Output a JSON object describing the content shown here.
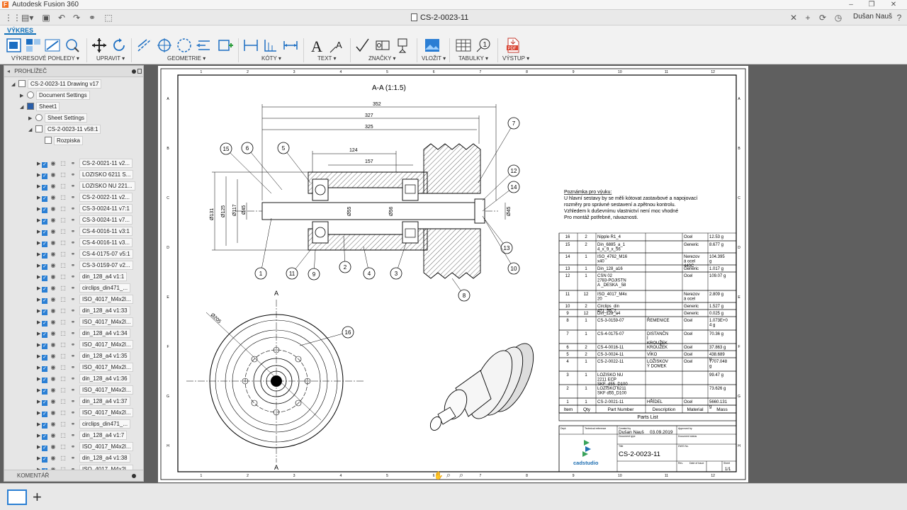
{
  "app": {
    "title": "Autodesk Fusion 360",
    "user": "Dušan Nauš",
    "document_tab": "CS-2-0023-11 Drawing v17"
  },
  "ribbon": {
    "tab": "VÝKRES",
    "groups": [
      "VÝKRESOVÉ POHLEDY ▾",
      "UPRAVIT ▾",
      "GEOMETRIE ▾",
      "KÓTY ▾",
      "TEXT ▾",
      "ZNAČKY ▾",
      "VLOŽIT ▾",
      "TABULKY ▾",
      "VÝSTUP ▾"
    ]
  },
  "browser": {
    "title": "PROHLÍŽEČ",
    "comments": "KOMENTÁŘ",
    "root": "CS-2-0023-11 Drawing v17",
    "document_settings": "Document Settings",
    "sheet": "Sheet1",
    "sheet_settings": "Sheet Settings",
    "view": "CS-2-0023-11 v58:1",
    "parts_list": "Rozpiska",
    "components": [
      "CS-2-0021-11 v2...",
      "LOZISKO 6211 S...",
      "LOZISKO NU 221...",
      "CS-2-0022-11 v2...",
      "CS-3-0024-11 v7:1",
      "CS-3-0024-11 v7...",
      "CS-4-0016-11 v3:1",
      "CS-4-0016-11 v3...",
      "CS-4-0175-07 v5:1",
      "CS-3-0159-07 v2...",
      "din_128_a4 v1:1",
      "circlips_din471_...",
      "ISO_4017_M4x2l...",
      "din_128_a4 v1:33",
      "ISO_4017_M4x2l...",
      "din_128_a4 v1:34",
      "ISO_4017_M4x2l...",
      "din_128_a4 v1:35",
      "ISO_4017_M4x2l...",
      "din_128_a4 v1:36",
      "ISO_4017_M4x2l...",
      "din_128_a4 v1:37",
      "ISO_4017_M4x2l...",
      "circlips_din471_...",
      "din_128_a4 v1:7",
      "ISO_4017_M4x2l...",
      "din_128_a4 v1:38",
      "ISO_4017_M4x2l..."
    ]
  },
  "drawing": {
    "section_title": "A-A (1:1.5)",
    "section_marker": "A",
    "dimensions": [
      "352",
      "327",
      "325",
      "124",
      "157",
      "Ø131",
      "Ø125",
      "Ø117",
      "Ø45",
      "Ø55",
      "Ø56",
      "Ø45",
      "Ø205"
    ],
    "balloons": [
      "15",
      "6",
      "5",
      "7",
      "12",
      "14",
      "13",
      "10",
      "8",
      "3",
      "4",
      "2",
      "9",
      "11",
      "1",
      "16"
    ],
    "note_title": "Poznámka pro výuku:",
    "note_lines": [
      "U hlavní sestavy by se měli kótovat zastavbové a napojovací",
      "rozměry pro správné sestavení a zpětnou kontrolu.",
      "Vzhledem k duševnímu vlastnictví není moc vhodné",
      "Pro montáž potřebné, návaznosti."
    ],
    "grid_cols": [
      "1",
      "2",
      "3",
      "4",
      "5",
      "6",
      "7",
      "8",
      "9",
      "10",
      "11",
      "12"
    ],
    "grid_rows": [
      "A",
      "B",
      "C",
      "D",
      "E",
      "F",
      "G",
      "H"
    ],
    "parts_list": {
      "title": "Parts List",
      "headers": [
        "Item",
        "Qty",
        "Part Number",
        "Description",
        "Material",
        "Mass"
      ],
      "rows": [
        [
          "16",
          "2",
          "Nipple R1_4",
          "",
          "Ocel",
          "12.53 g"
        ],
        [
          "15",
          "2",
          "Din_6885_a_14_x_9_x_56",
          "",
          "Generic",
          "8.677 g"
        ],
        [
          "14",
          "1",
          "ISO_4762_M16x40",
          "",
          "Nerezová ocel 440C",
          "104.395 g"
        ],
        [
          "13",
          "1",
          "Din_128_a16",
          "",
          "Generic",
          "1.017 g"
        ],
        [
          "12",
          "1",
          "CSN 02 2783-POJISTNA _DESKA _58",
          "",
          "Ocel",
          "109.07 g"
        ],
        [
          "11",
          "12",
          "ISO_4017_M4x20",
          "",
          "Nerezová ocel",
          "2.809 g"
        ],
        [
          "10",
          "2",
          "Circlips_din471_55_2",
          "",
          "Generic",
          "1.527 g"
        ],
        [
          "9",
          "12",
          "Din_128_a4",
          "",
          "Generic",
          "0.025 g"
        ],
        [
          "8",
          "1",
          "CS-3-0159-07",
          "ŘEMENICE",
          "Ocel",
          "1.073E+04 g"
        ],
        [
          "7",
          "1",
          "CS-4-0175-07",
          "DISTANČNÍ KROUŽEK",
          "Ocel",
          "70.36 g"
        ],
        [
          "6",
          "2",
          "CS-4-0016-11",
          "KROUŽEK",
          "Ocel",
          "37.863 g"
        ],
        [
          "5",
          "2",
          "CS-3-0024-11",
          "VÍKO",
          "Ocel",
          "438.689 g"
        ],
        [
          "4",
          "1",
          "CS-2-0022-11",
          "LOŽISKOVÝ DOMEK",
          "Ocel",
          "7707.048 g"
        ],
        [
          "3",
          "1",
          "LOZISKO NU 2211 ECP SKF_d55_D100",
          "",
          "",
          "99.47 g"
        ],
        [
          "2",
          "1",
          "LOZISKO 6211 SKF d55_D100",
          "",
          "",
          "73.626 g"
        ],
        [
          "1",
          "1",
          "CS-2-0021-11",
          "HŘÍDEL",
          "Ocel",
          "5660.131 g"
        ]
      ]
    },
    "title_block": {
      "dept_label": "Dept.",
      "tech_ref_label": "Technical reference",
      "created_by_label": "Created by",
      "approved_by_label": "Approved by",
      "created_by": "Dušan Nauš",
      "date": "03.09.2019",
      "doc_type_label": "Document type",
      "doc_status_label": "Document status",
      "title_label": "Title",
      "dwg_no_label": "DWG No.",
      "title": "CS-2-0023-11",
      "rev_label": "Rev.",
      "date_issue_label": "Date of issue",
      "sheet_label": "Sheet",
      "sheet_value": "1/1",
      "logo": "cadstudio"
    }
  }
}
